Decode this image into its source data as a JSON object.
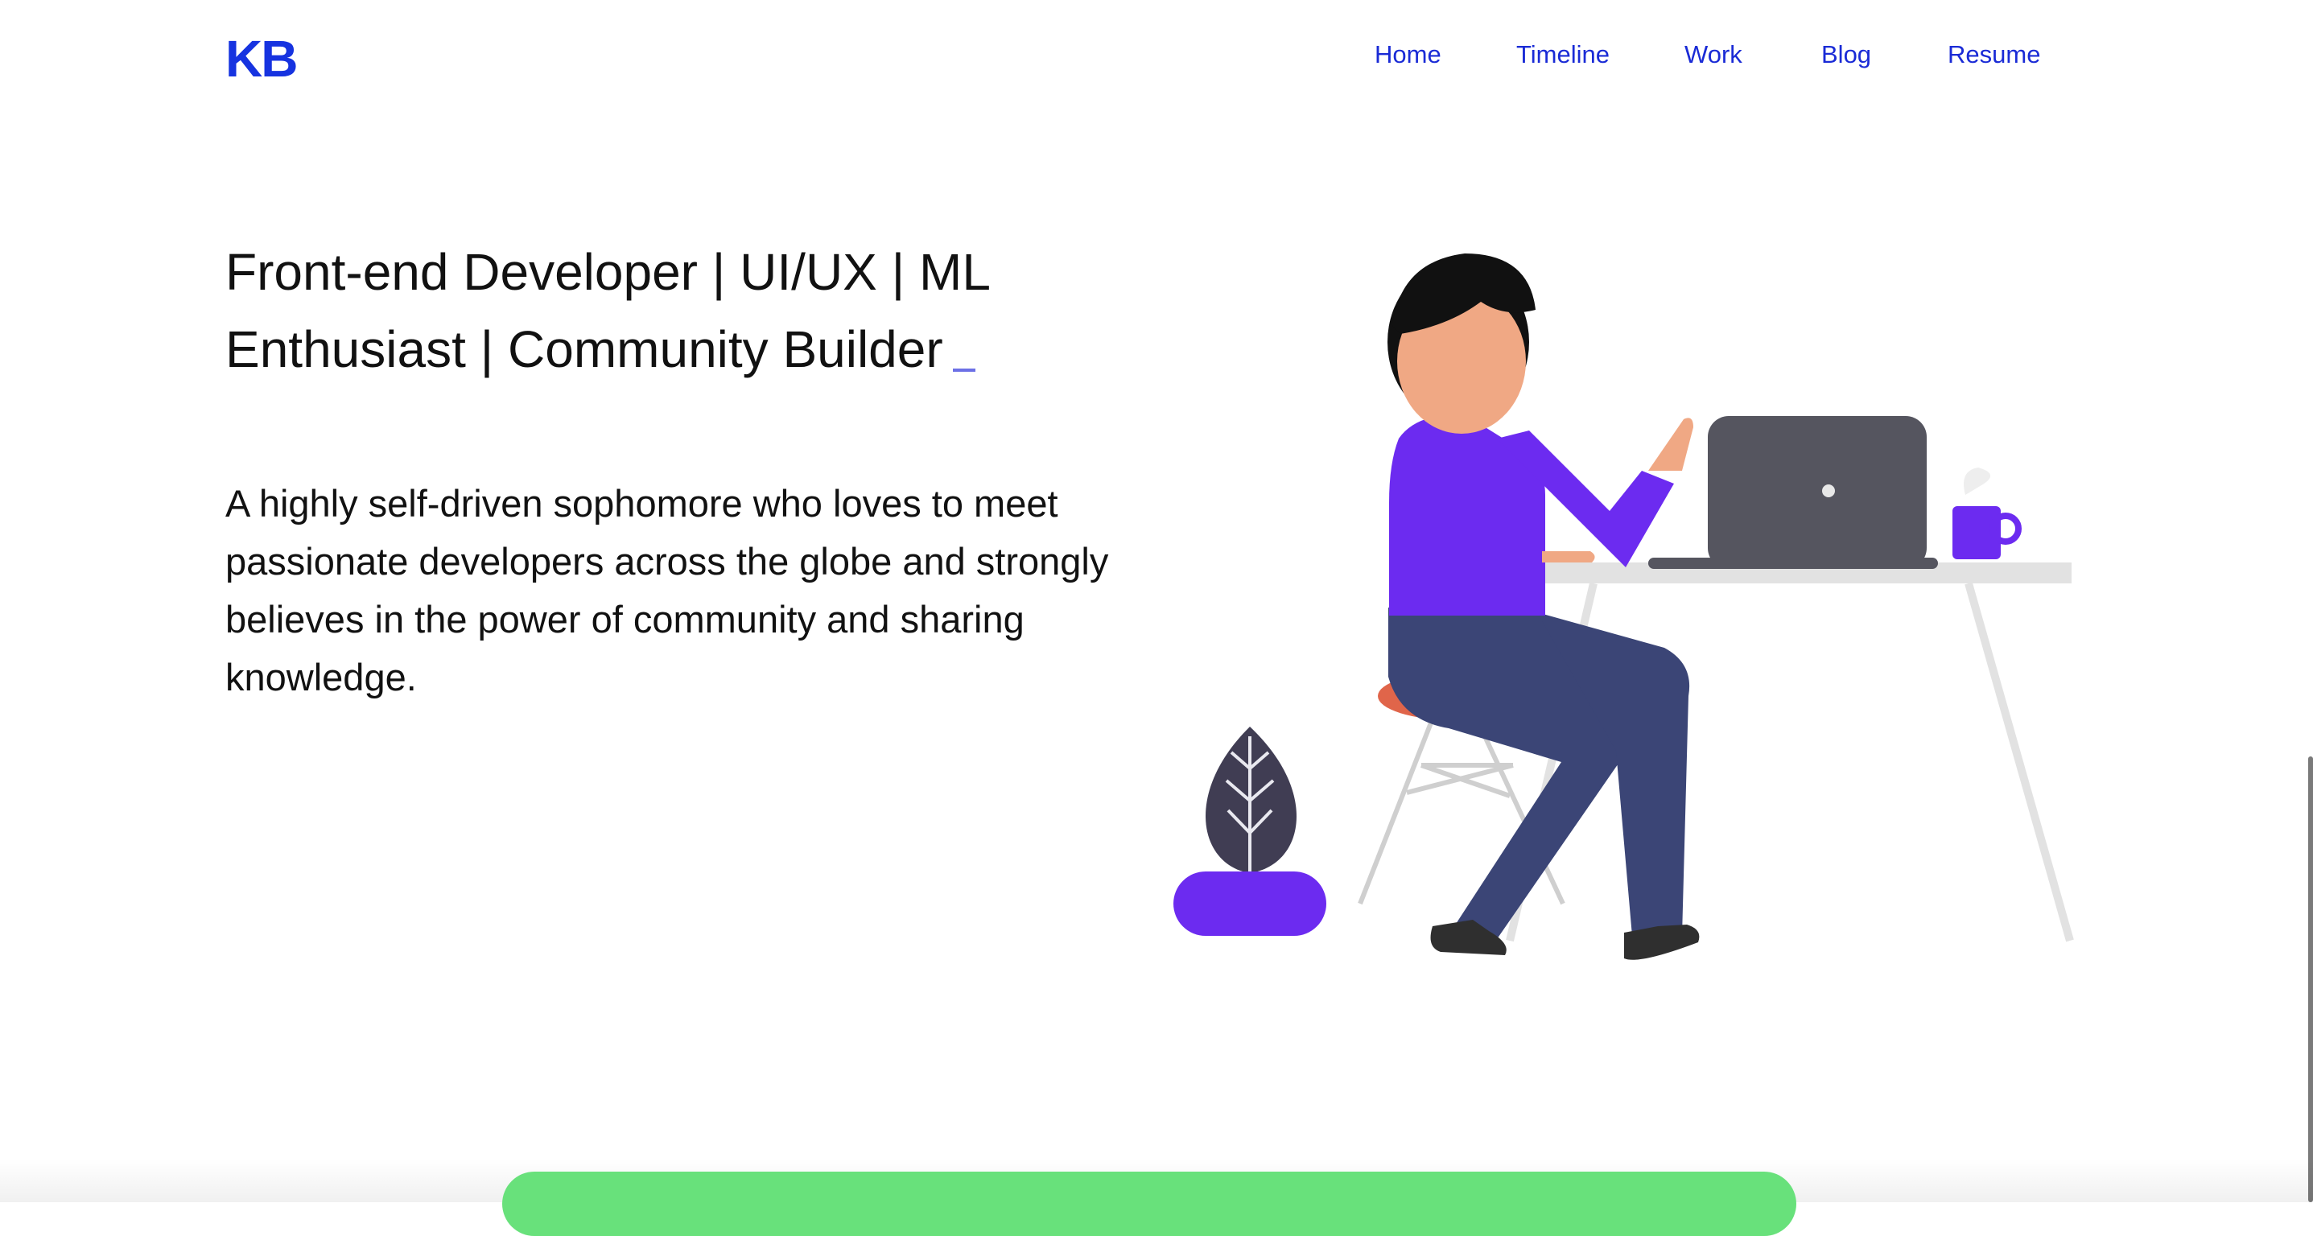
{
  "header": {
    "logo": "KB",
    "nav": [
      {
        "label": "Home"
      },
      {
        "label": "Timeline"
      },
      {
        "label": "Work"
      },
      {
        "label": "Blog"
      },
      {
        "label": "Resume"
      }
    ]
  },
  "hero": {
    "headline": "Front-end Developer | UI/UX | ML Enthusiast | Community Builder",
    "description": "A highly self-driven sophomore who loves to meet passionate developers across the globe and strongly believes in the power of community and sharing knowledge."
  },
  "colors": {
    "accent": "#1633e0",
    "shirt": "#6c2bf0",
    "pants": "#3b4576",
    "laptop": "#55555f",
    "stool_seat": "#e0654a",
    "green_card": "#68e17b"
  }
}
